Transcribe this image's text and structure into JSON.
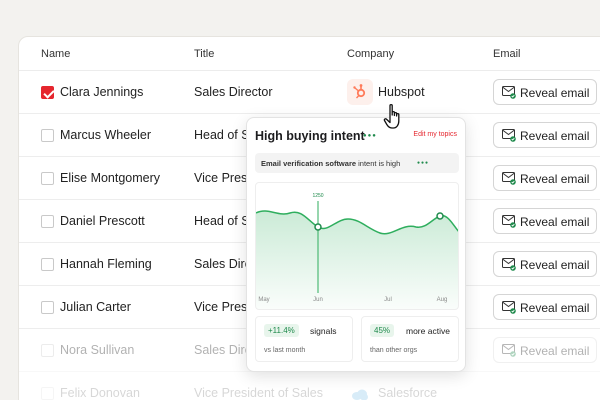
{
  "table": {
    "headers": {
      "name": "Name",
      "title": "Title",
      "company": "Company",
      "email": "Email"
    },
    "reveal_label": "Reveal email",
    "rows": [
      {
        "name": "Clara Jennings",
        "title": "Sales Director",
        "company": "Hubspot",
        "checked": true
      },
      {
        "name": "Marcus Wheeler",
        "title": "Head of S",
        "company": "",
        "checked": false
      },
      {
        "name": "Elise Montgomery",
        "title": "Vice Presi",
        "company": "",
        "checked": false
      },
      {
        "name": "Daniel Prescott",
        "title": "Head of S",
        "company": "",
        "checked": false
      },
      {
        "name": "Hannah Fleming",
        "title": "Sales Dire",
        "company": "",
        "checked": false
      },
      {
        "name": "Julian Carter",
        "title": "Vice Presi",
        "company": "",
        "checked": false
      },
      {
        "name": "Nora Sullivan",
        "title": "Sales Dire",
        "company": "",
        "checked": false
      },
      {
        "name": "Felix Donovan",
        "title": "Vice President of Sales",
        "company": "Salesforce",
        "checked": false
      }
    ]
  },
  "popup": {
    "title": "High buying intent",
    "edit_link": "Edit my topics",
    "topic": {
      "keyword": "Email verification software",
      "suffix": " intent is high"
    },
    "chart": {
      "peak_label": "1250",
      "months": [
        "May",
        "Jun",
        "Jul",
        "Aug"
      ]
    },
    "stats": [
      {
        "value": "+11.4%",
        "label": "signals",
        "sub": "vs last month"
      },
      {
        "value": "45%",
        "label": "more active",
        "sub": "than other orgs"
      }
    ]
  },
  "colors": {
    "accent": "#e5262e",
    "positive": "#1f8a4c",
    "hubspot": "#ff7a59"
  },
  "chart_data": {
    "type": "area",
    "x": [
      "May",
      "Jun",
      "Jul",
      "Aug"
    ],
    "annotations": [
      "1250"
    ]
  }
}
